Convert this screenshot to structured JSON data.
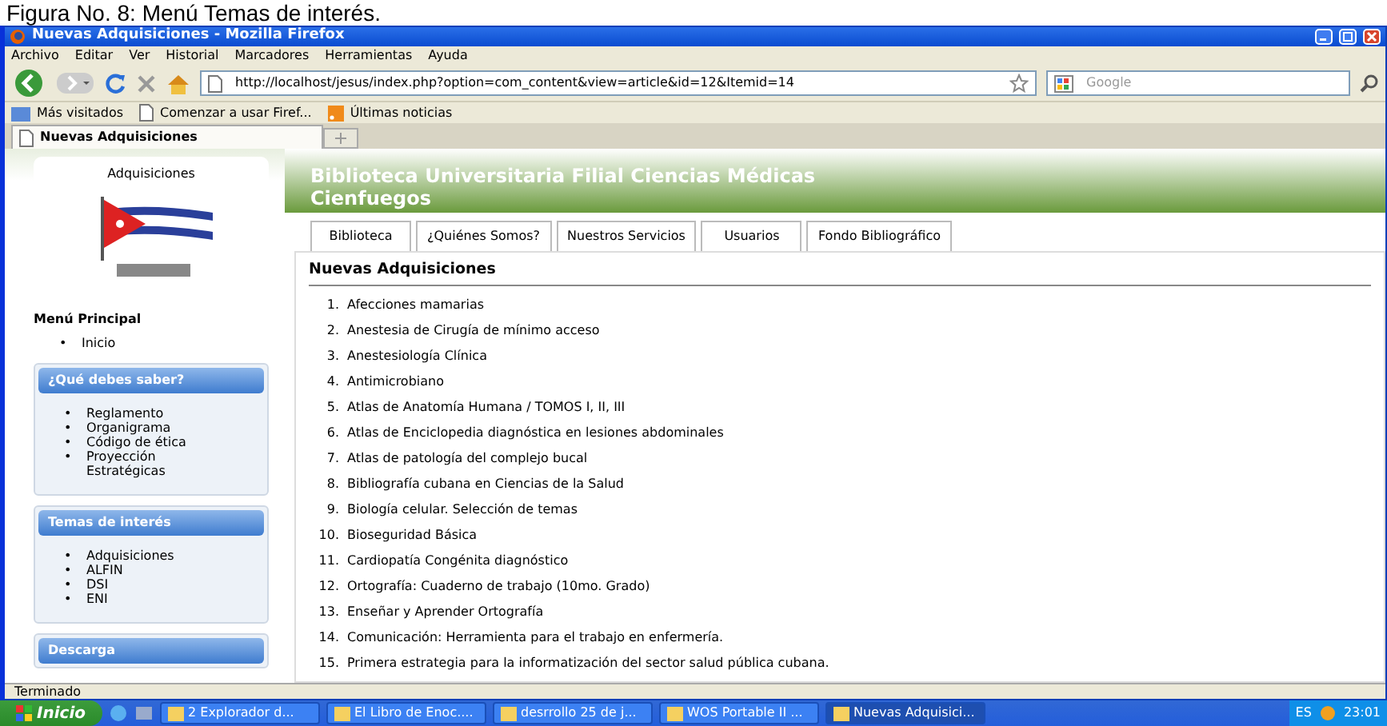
{
  "caption": "Figura No. 8: Menú Temas de interés.",
  "window": {
    "title": "Nuevas Adquisiciones - Mozilla Firefox"
  },
  "menu_bar": [
    "Archivo",
    "Editar",
    "Ver",
    "Historial",
    "Marcadores",
    "Herramientas",
    "Ayuda"
  ],
  "address_bar": {
    "url": "http://localhost/jesus/index.php?option=com_content&view=article&id=12&Itemid=14"
  },
  "search": {
    "placeholder": "Google"
  },
  "bookmarks": [
    "Más visitados",
    "Comenzar a usar Firef...",
    "Últimas noticias"
  ],
  "browser_tabs": [
    {
      "label": "Nuevas Adquisiciones",
      "selected": true
    }
  ],
  "sidebar": {
    "bullet": "•",
    "top_label": "Adquisiciones",
    "main_menu": {
      "title": "Menú Principal",
      "items": [
        "Inicio"
      ]
    },
    "modules": [
      {
        "title": "¿Qué debes saber?",
        "items": [
          "Reglamento",
          "Organigrama",
          "Código de ética",
          "Proyección Estratégicas"
        ]
      },
      {
        "title": "Temas de interés",
        "items": [
          "Adquisiciones",
          "ALFIN",
          "DSI",
          "ENI"
        ]
      },
      {
        "title": "Descarga"
      }
    ]
  },
  "site_title": "Biblioteca Universitaria Filial Ciencias Médicas Cienfuegos",
  "nav_tabs": [
    {
      "label": "Biblioteca",
      "selected": false
    },
    {
      "label": "¿Quiénes Somos?",
      "selected": false
    },
    {
      "label": "Nuestros Servicios",
      "selected": false
    },
    {
      "label": "Usuarios",
      "selected": false
    },
    {
      "label": "Fondo Bibliográfico",
      "selected": false
    }
  ],
  "article": {
    "title": "Nuevas Adquisiciones",
    "items": [
      {
        "n": "1.",
        "text": "Afecciones mamarias"
      },
      {
        "n": "2.",
        "text": "Anestesia de Cirugía de mínimo acceso"
      },
      {
        "n": "3.",
        "text": "Anestesiología Clínica"
      },
      {
        "n": "4.",
        "text": "Antimicrobiano"
      },
      {
        "n": "5.",
        "text": "Atlas de Anatomía Humana / TOMOS I, II, III"
      },
      {
        "n": "6.",
        "text": "Atlas de Enciclopedia diagnóstica en lesiones abdominales"
      },
      {
        "n": "7.",
        "text": "Atlas de patología del complejo bucal"
      },
      {
        "n": "8.",
        "text": "Bibliografía cubana en Ciencias de la Salud"
      },
      {
        "n": "9.",
        "text": "Biología celular. Selección de temas"
      },
      {
        "n": "10.",
        "text": "Bioseguridad Básica"
      },
      {
        "n": "11.",
        "text": "Cardiopatía Congénita diagnóstico"
      },
      {
        "n": "12.",
        "text": "Ortografía: Cuaderno de trabajo (10mo. Grado)"
      },
      {
        "n": "13.",
        "text": "Enseñar y Aprender Ortografía"
      },
      {
        "n": "14.",
        "text": "Comunicación: Herramienta para el trabajo en enfermería."
      },
      {
        "n": "15.",
        "text": "Primera estrategia para la informatización del sector salud pública cubana."
      }
    ]
  },
  "status_bar": "Terminado",
  "taskbar": {
    "start": "Inicio",
    "tasks": [
      {
        "label": "2 Explorador d...",
        "selected": false
      },
      {
        "label": "El Libro de Enoc....",
        "selected": false
      },
      {
        "label": "desrrollo 25 de j...",
        "selected": false
      },
      {
        "label": "WOS Portable II ...",
        "selected": false
      },
      {
        "label": "Nuevas Adquisici...",
        "selected": true
      }
    ],
    "language": "ES",
    "clock": "23:01"
  }
}
